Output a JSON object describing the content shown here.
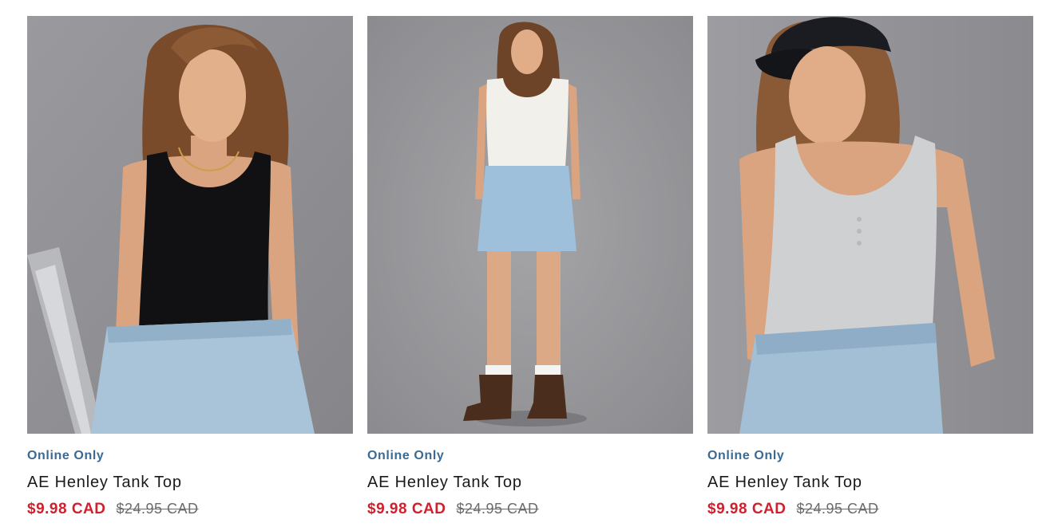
{
  "theme": {
    "badge_color": "#3b6a93",
    "sale_color": "#d0202d",
    "original_price_color": "#6b6b6b"
  },
  "products": [
    {
      "badge": "Online Only",
      "name": "AE Henley Tank Top",
      "sale_price": "$9.98 CAD",
      "original_price": "$24.95 CAD",
      "image": {
        "top_color": "black",
        "bottom": "light-wash jeans",
        "pose": "seated"
      }
    },
    {
      "badge": "Online Only",
      "name": "AE Henley Tank Top",
      "sale_price": "$9.98 CAD",
      "original_price": "$24.95 CAD",
      "image": {
        "top_color": "white",
        "bottom": "denim mini skirt",
        "pose": "standing full-length"
      }
    },
    {
      "badge": "Online Only",
      "name": "AE Henley Tank Top",
      "sale_price": "$9.98 CAD",
      "original_price": "$24.95 CAD",
      "image": {
        "top_color": "heather grey",
        "bottom": "light-wash jeans",
        "pose": "standing with cap"
      }
    }
  ]
}
